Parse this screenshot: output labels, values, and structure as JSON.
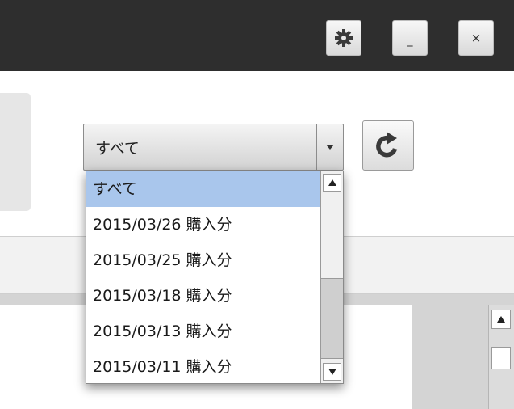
{
  "titlebar": {
    "settings_icon": "gear-icon",
    "minimize_label": "_",
    "close_label": "×"
  },
  "filter": {
    "selected_value": "すべて",
    "arrow_icon": "triangle-down-icon"
  },
  "refresh": {
    "icon": "refresh-icon"
  },
  "dropdown": {
    "options": [
      {
        "label": "すべて",
        "selected": true
      },
      {
        "label": "2015/03/26 購入分",
        "selected": false
      },
      {
        "label": "2015/03/25 購入分",
        "selected": false
      },
      {
        "label": "2015/03/18 購入分",
        "selected": false
      },
      {
        "label": "2015/03/13 購入分",
        "selected": false
      },
      {
        "label": "2015/03/11 購入分",
        "selected": false
      }
    ]
  },
  "colors": {
    "titlebar_bg": "#2e2e2e",
    "selected_option_bg": "#a9c6ec"
  }
}
